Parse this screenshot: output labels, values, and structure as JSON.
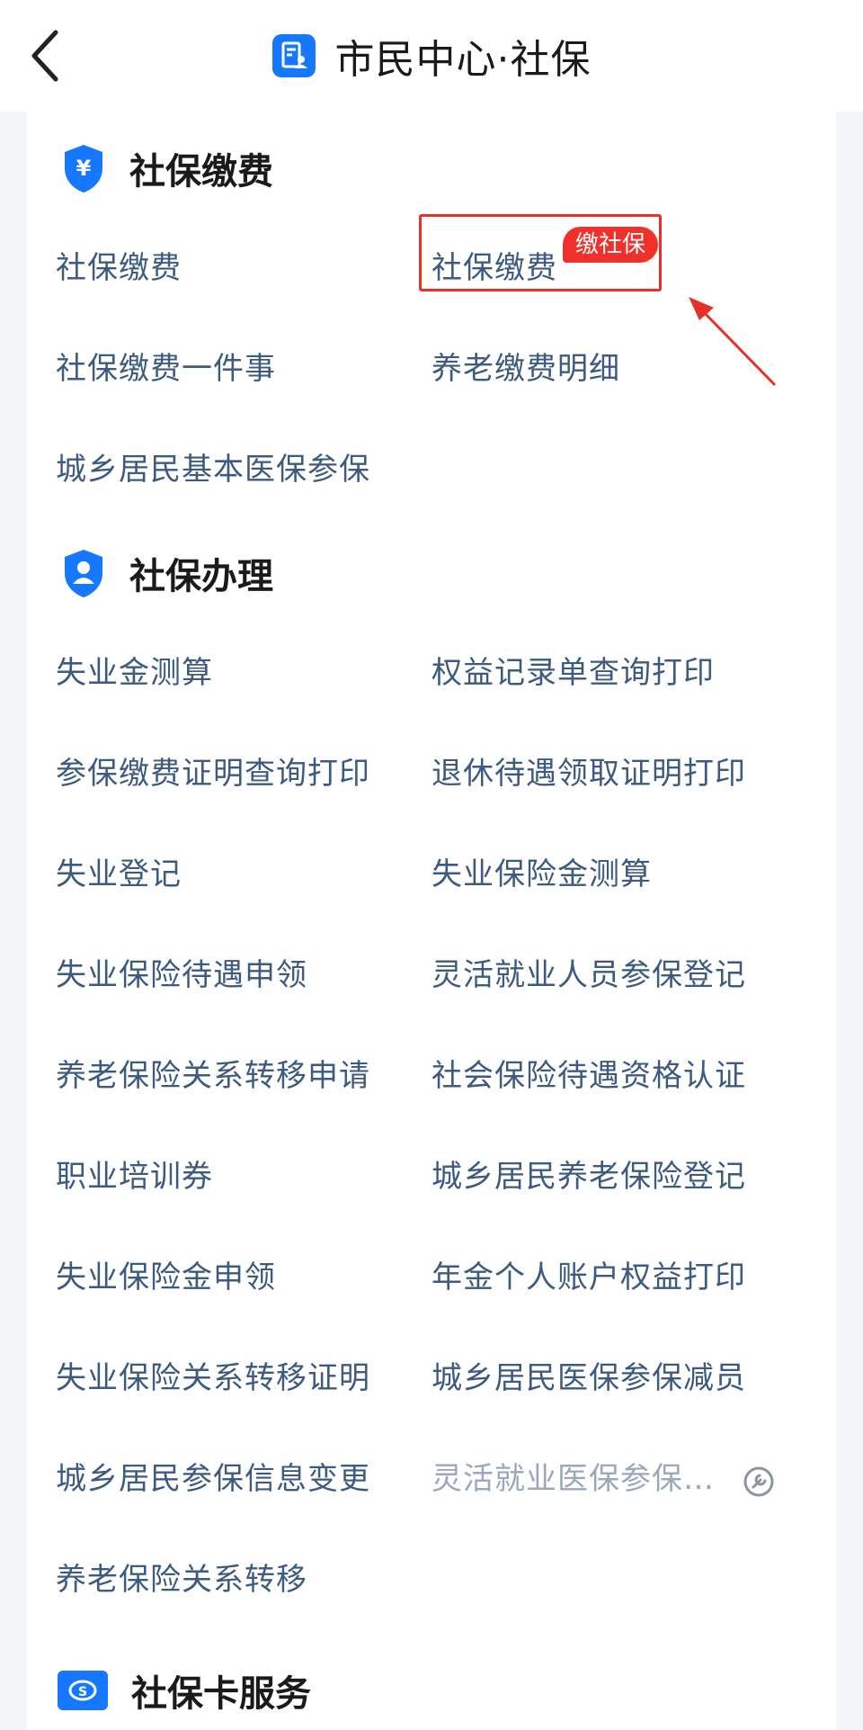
{
  "header": {
    "title": "市民中心·社保",
    "back_icon": "chevron-left-icon",
    "app_icon": "document-person-icon"
  },
  "sections": [
    {
      "title": "社保缴费",
      "icon": "shield-yuan-icon",
      "items": [
        "社保缴费",
        "社保缴费",
        "社保缴费一件事",
        "养老缴费明细",
        "城乡居民基本医保参保"
      ]
    },
    {
      "title": "社保办理",
      "icon": "shield-person-icon",
      "items": [
        "失业金测算",
        "权益记录单查询打印",
        "参保缴费证明查询打印",
        "退休待遇领取证明打印",
        "失业登记",
        "失业保险金测算",
        "失业保险待遇申领",
        "灵活就业人员参保登记",
        "养老保险关系转移申请",
        "社会保险待遇资格认证",
        "职业培训券",
        "城乡居民养老保险登记",
        "失业保险金申领",
        "年金个人账户权益打印",
        "失业保险关系转移证明",
        "城乡居民医保参保减员",
        "城乡居民参保信息变更",
        "灵活就业医保参保…",
        "养老保险关系转移"
      ]
    },
    {
      "title": "社保卡服务",
      "icon": "social-security-card-icon",
      "items": []
    }
  ],
  "highlight_badge": "缴社保",
  "colors": {
    "accent": "#1677ff",
    "item_text": "#3d5a80",
    "highlight": "#e8302a"
  }
}
